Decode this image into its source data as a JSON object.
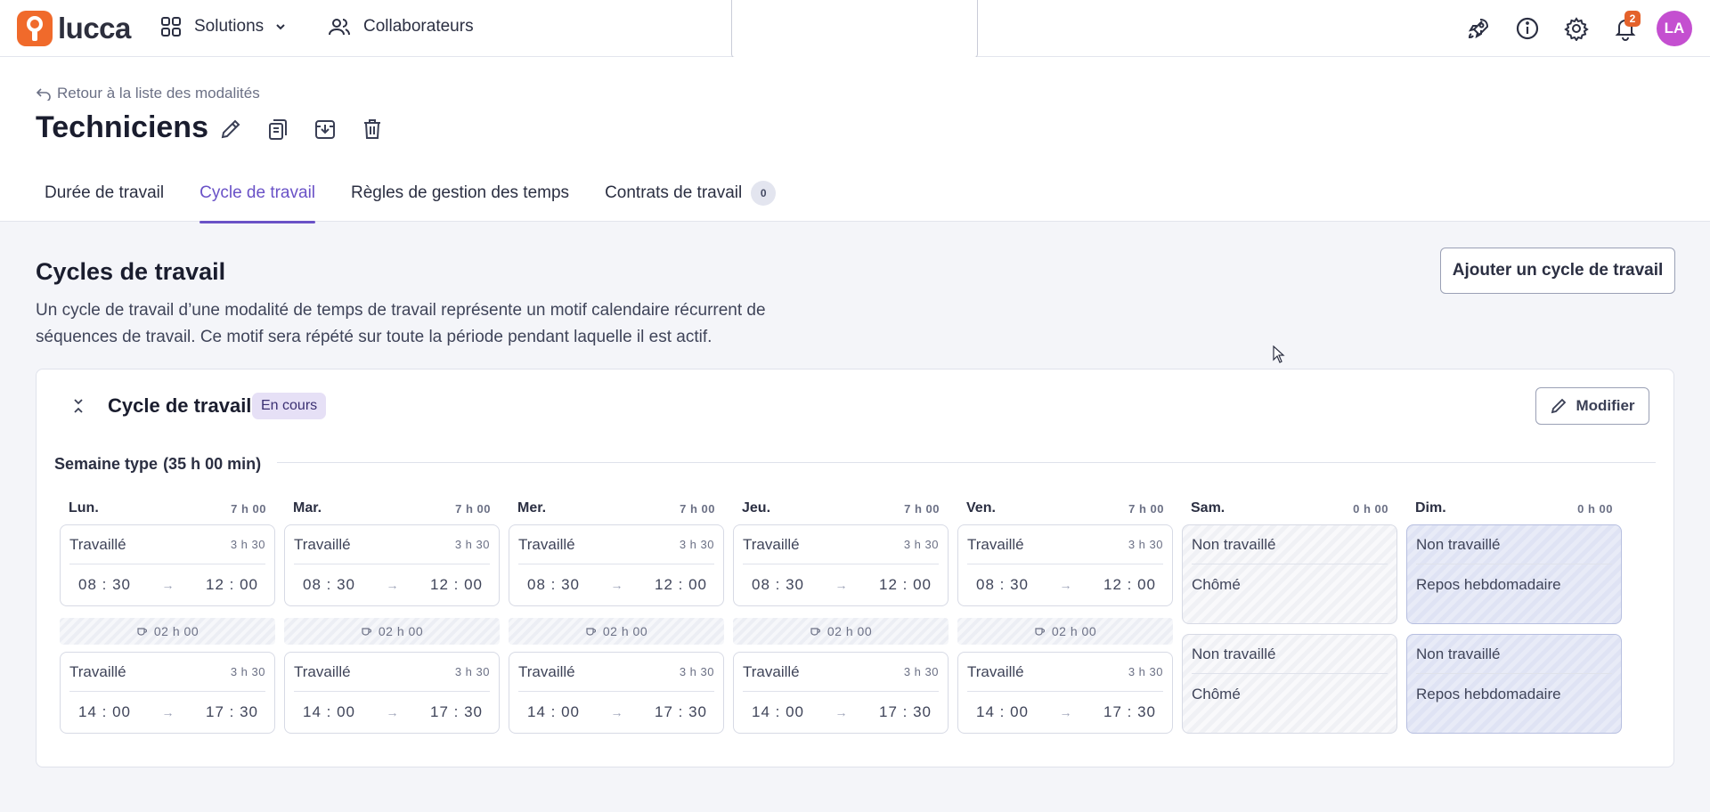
{
  "app": {
    "logo_text": "lucca",
    "nav": {
      "solutions": "Solutions",
      "collaborateurs": "Collaborateurs"
    },
    "notifications_count": "2",
    "avatar_initials": "LA"
  },
  "header": {
    "back_link": "Retour à la liste des modalités",
    "title": "Techniciens",
    "tabs": [
      {
        "label": "Durée de travail"
      },
      {
        "label": "Cycle de travail"
      },
      {
        "label": "Règles de gestion des temps"
      },
      {
        "label": "Contrats de travail",
        "count": "0"
      }
    ]
  },
  "section": {
    "title": "Cycles de travail",
    "description": "Un cycle de travail d’une modalité de temps de travail représente un motif calendaire récurrent de séquences de travail. Ce motif sera répété sur toute la période pendant laquelle il est actif.",
    "add_button": "Ajouter un cycle de travail"
  },
  "cycle": {
    "title": "Cycle de travail",
    "status": "En cours",
    "modify_button": "Modifier",
    "week_label": "Semaine type",
    "week_total": "(35 h 00 min)",
    "days": [
      {
        "name": "Lun.",
        "hours": "7 h 00",
        "morning": {
          "type": "Travaillé",
          "duration": "3 h 30",
          "start": "08 : 30",
          "end": "12 : 00"
        },
        "pause": "02 h 00",
        "afternoon": {
          "type": "Travaillé",
          "duration": "3 h 30",
          "start": "14 : 00",
          "end": "17 : 30"
        }
      },
      {
        "name": "Mar.",
        "hours": "7 h 00",
        "morning": {
          "type": "Travaillé",
          "duration": "3 h 30",
          "start": "08 : 30",
          "end": "12 : 00"
        },
        "pause": "02 h 00",
        "afternoon": {
          "type": "Travaillé",
          "duration": "3 h 30",
          "start": "14 : 00",
          "end": "17 : 30"
        }
      },
      {
        "name": "Mer.",
        "hours": "7 h 00",
        "morning": {
          "type": "Travaillé",
          "duration": "3 h 30",
          "start": "08 : 30",
          "end": "12 : 00"
        },
        "pause": "02 h 00",
        "afternoon": {
          "type": "Travaillé",
          "duration": "3 h 30",
          "start": "14 : 00",
          "end": "17 : 30"
        }
      },
      {
        "name": "Jeu.",
        "hours": "7 h 00",
        "morning": {
          "type": "Travaillé",
          "duration": "3 h 30",
          "start": "08 : 30",
          "end": "12 : 00"
        },
        "pause": "02 h 00",
        "afternoon": {
          "type": "Travaillé",
          "duration": "3 h 30",
          "start": "14 : 00",
          "end": "17 : 30"
        }
      },
      {
        "name": "Ven.",
        "hours": "7 h 00",
        "morning": {
          "type": "Travaillé",
          "duration": "3 h 30",
          "start": "08 : 30",
          "end": "12 : 00"
        },
        "pause": "02 h 00",
        "afternoon": {
          "type": "Travaillé",
          "duration": "3 h 30",
          "start": "14 : 00",
          "end": "17 : 30"
        }
      },
      {
        "name": "Sam.",
        "hours": "0 h 00",
        "morning": {
          "type": "Non travaillé",
          "reason": "Chômé"
        },
        "afternoon": {
          "type": "Non travaillé",
          "reason": "Chômé"
        }
      },
      {
        "name": "Dim.",
        "hours": "0 h 00",
        "morning": {
          "type": "Non travaillé",
          "reason": "Repos hebdomadaire"
        },
        "afternoon": {
          "type": "Non travaillé",
          "reason": "Repos hebdomadaire"
        }
      }
    ]
  }
}
